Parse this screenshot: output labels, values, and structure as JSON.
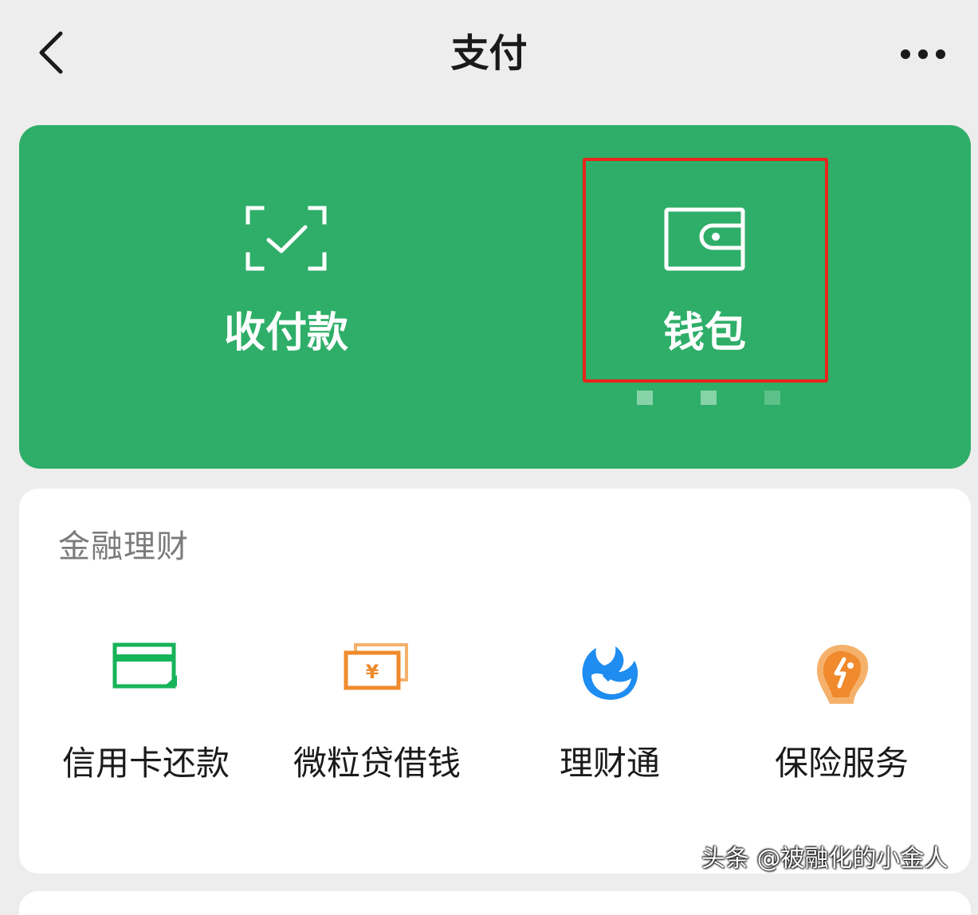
{
  "header": {
    "title": "支付",
    "back_icon": "chevron-left-icon",
    "more_icon": "more-dots-icon"
  },
  "payment_card": {
    "background_color": "#2eae68",
    "actions": [
      {
        "label": "收付款",
        "icon": "scan-check-icon"
      },
      {
        "label": "钱包",
        "icon": "wallet-icon"
      }
    ],
    "highlight_color": "#e8251c"
  },
  "finance": {
    "section_title": "金融理财",
    "items": [
      {
        "label": "信用卡还款",
        "icon": "credit-card-icon",
        "color": "#17b35a"
      },
      {
        "label": "微粒贷借钱",
        "icon": "loan-money-icon",
        "color": "#f08a2c"
      },
      {
        "label": "理财通",
        "icon": "wealth-drop-icon",
        "color": "#1e8cf0"
      },
      {
        "label": "保险服务",
        "icon": "insurance-shield-icon",
        "color": "#f0962c"
      }
    ]
  },
  "watermark": "头条 @被融化的小金人"
}
